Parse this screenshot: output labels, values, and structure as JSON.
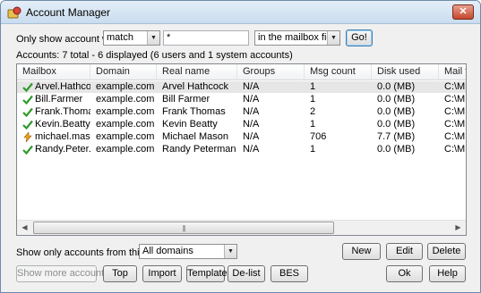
{
  "window": {
    "title": "Account Manager",
    "close_label": "✕"
  },
  "filter": {
    "prefix_label": "Only show account which",
    "match_value": "match",
    "pattern_value": "*",
    "field_value": "in the mailbox field",
    "go_label": "Go!"
  },
  "summary": "Accounts:  7 total - 6 displayed (6 users and 1 system accounts)",
  "columns": [
    "Mailbox",
    "Domain",
    "Real name",
    "Groups",
    "Msg count",
    "Disk used",
    "Mail fol"
  ],
  "rows": [
    {
      "icon": "check-icon",
      "mailbox": "Arvel.Hathco...",
      "domain": "example.com",
      "real_name": "Arvel Hathcock",
      "groups": "N/A",
      "msg_count": "1",
      "disk_used": "0.0 (MB)",
      "mail_folder": "C:\\MDa",
      "selected": true
    },
    {
      "icon": "check-icon",
      "mailbox": "Bill.Farmer",
      "domain": "example.com",
      "real_name": "Bill Farmer",
      "groups": "N/A",
      "msg_count": "1",
      "disk_used": "0.0 (MB)",
      "mail_folder": "C:\\MDa",
      "selected": false
    },
    {
      "icon": "check-icon",
      "mailbox": "Frank.Thomas",
      "domain": "example.com",
      "real_name": "Frank Thomas",
      "groups": "N/A",
      "msg_count": "2",
      "disk_used": "0.0 (MB)",
      "mail_folder": "C:\\MDa",
      "selected": false
    },
    {
      "icon": "check-icon",
      "mailbox": "Kevin.Beatty",
      "domain": "example.com",
      "real_name": "Kevin Beatty",
      "groups": "N/A",
      "msg_count": "1",
      "disk_used": "0.0 (MB)",
      "mail_folder": "C:\\MDa",
      "selected": false
    },
    {
      "icon": "lightning-icon",
      "mailbox": "michael.mason",
      "domain": "example.com",
      "real_name": "Michael Mason",
      "groups": "N/A",
      "msg_count": "706",
      "disk_used": "7.7 (MB)",
      "mail_folder": "C:\\MDa",
      "selected": false
    },
    {
      "icon": "check-icon",
      "mailbox": "Randy.Peter...",
      "domain": "example.com",
      "real_name": "Randy Peterman",
      "groups": "N/A",
      "msg_count": "1",
      "disk_used": "0.0 (MB)",
      "mail_folder": "C:\\MDa",
      "selected": false
    }
  ],
  "scrollbar": {
    "left_arrow": "◀",
    "right_arrow": "▶",
    "grip": "|||"
  },
  "domain_filter": {
    "label": "Show only accounts from this domain",
    "value": "All domains"
  },
  "buttons": {
    "new": "New",
    "edit": "Edit",
    "delete": "Delete",
    "show_more": "Show more accounts",
    "top": "Top",
    "import": "Import",
    "templates": "Templates",
    "delist": "De-list",
    "bes": "BES",
    "ok": "Ok",
    "help": "Help"
  },
  "colors": {
    "check": "#2f9a2a",
    "lightning": "#e9a21f",
    "selection": "#e6e6e6"
  }
}
